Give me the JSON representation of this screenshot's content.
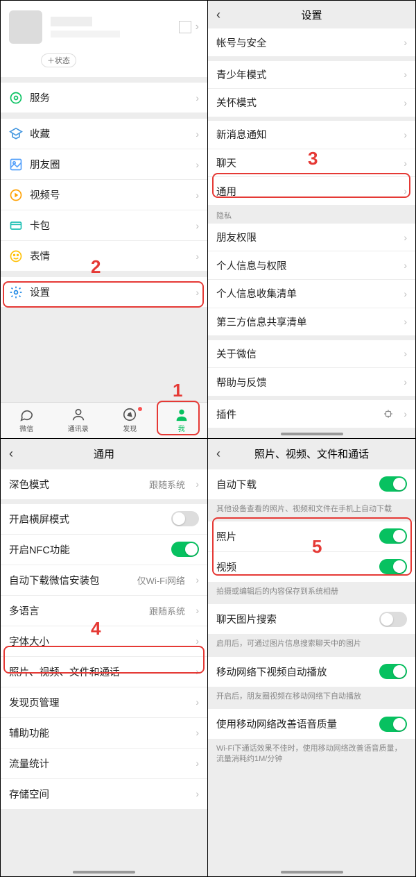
{
  "annotations": {
    "n1": "1",
    "n2": "2",
    "n3": "3",
    "n4": "4",
    "n5": "5"
  },
  "pane1": {
    "status_chip": "＋状态",
    "rows": {
      "services": "服务",
      "favorites": "收藏",
      "moments": "朋友圈",
      "channels": "视频号",
      "cards": "卡包",
      "stickers": "表情",
      "settings": "设置"
    },
    "tabs": {
      "chat": "微信",
      "contacts": "通讯录",
      "discover": "发现",
      "me": "我"
    }
  },
  "pane2": {
    "title": "设置",
    "rows": {
      "account": "帐号与安全",
      "teen": "青少年模式",
      "care": "关怀模式",
      "notif": "新消息通知",
      "chat": "聊天",
      "general": "通用",
      "privacy_hdr": "隐私",
      "friends_perm": "朋友权限",
      "personal_perm": "个人信息与权限",
      "collect_list": "个人信息收集清单",
      "thirdparty": "第三方信息共享清单",
      "about": "关于微信",
      "help": "帮助与反馈",
      "plugins": "插件"
    }
  },
  "pane3": {
    "title": "通用",
    "rows": {
      "dark": "深色模式",
      "dark_val": "跟随系统",
      "landscape": "开启横屏模式",
      "nfc": "开启NFC功能",
      "autodl": "自动下载微信安装包",
      "autodl_val": "仅Wi-Fi网络",
      "lang": "多语言",
      "lang_val": "跟随系统",
      "font": "字体大小",
      "media": "照片、视频、文件和通话",
      "discover": "发现页管理",
      "access": "辅助功能",
      "traffic": "流量统计",
      "storage": "存储空间"
    },
    "toggles": {
      "landscape": false,
      "nfc": true
    }
  },
  "pane4": {
    "title": "照片、视频、文件和通话",
    "rows": {
      "autodl": "自动下载",
      "autodl_note": "其他设备查看的照片、视频和文件在手机上自动下载",
      "photo": "照片",
      "video": "视频",
      "album_note": "拍摄或编辑后的内容保存到系统相册",
      "chatimg": "聊天图片搜索",
      "chatimg_note": "启用后，可通过图片信息搜索聊天中的图片",
      "cellplay": "移动网络下视频自动播放",
      "cellplay_note": "开启后，朋友圈视频在移动网络下自动播放",
      "voip": "使用移动网络改善语音质量",
      "voip_note": "Wi-Fi下通话效果不佳时，使用移动网络改善语音质量，流量消耗约1M/分钟"
    },
    "toggles": {
      "autodl": true,
      "photo": true,
      "video": true,
      "chatimg": false,
      "cellplay": true,
      "voip": true
    }
  }
}
